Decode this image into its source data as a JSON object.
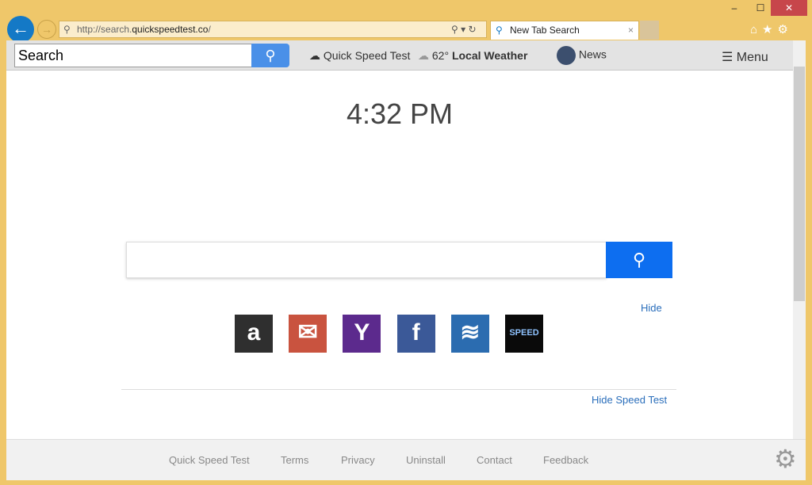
{
  "window": {
    "minimize": "–",
    "maximize": "☐",
    "close": "✕"
  },
  "address": {
    "prefix": "http://search.",
    "domain": "quickspeedtest.co",
    "suffix": "/"
  },
  "tab": {
    "title": "New Tab Search",
    "close": "×"
  },
  "toolbar": {
    "search_value": "Search",
    "speed_test": "Quick Speed Test",
    "temp": "62°",
    "weather": "Local Weather",
    "news": "News",
    "menu": "Menu"
  },
  "main": {
    "time": "4:32 PM",
    "hide": "Hide",
    "hide_speed": "Hide Speed Test"
  },
  "shortcuts": [
    {
      "name": "amazon",
      "label": "a",
      "color": "#2f2f2f"
    },
    {
      "name": "gmail",
      "label": "✉",
      "color": "#c9533f"
    },
    {
      "name": "yahoo",
      "label": "Y",
      "color": "#5c2a8d"
    },
    {
      "name": "facebook",
      "label": "f",
      "color": "#3b5998"
    },
    {
      "name": "wifi",
      "label": "≋",
      "color": "#2b6cb0"
    },
    {
      "name": "speed",
      "label": "SPEED",
      "color": "#0a0a0a"
    }
  ],
  "footer": [
    "Quick Speed Test",
    "Terms",
    "Privacy",
    "Uninstall",
    "Contact",
    "Feedback"
  ]
}
